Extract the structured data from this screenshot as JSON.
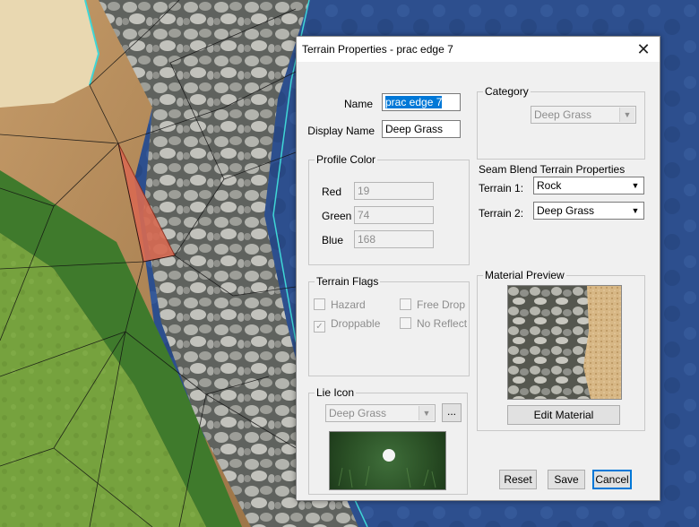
{
  "window": {
    "title": "Terrain Properties - prac edge 7",
    "close_glyph": "✕"
  },
  "fields": {
    "name_label": "Name",
    "name_value": "prac edge 7",
    "display_name_label": "Display Name",
    "display_name_value": "Deep Grass"
  },
  "profile_color": {
    "label": "Profile Color",
    "red_label": "Red",
    "red": "19",
    "green_label": "Green",
    "green": "74",
    "blue_label": "Blue",
    "blue": "168"
  },
  "terrain_flags": {
    "label": "Terrain Flags",
    "hazard": "Hazard",
    "free_drop": "Free Drop",
    "droppable": "Droppable",
    "no_reflect": "No Reflect"
  },
  "lie_icon": {
    "label": "Lie Icon",
    "value": "Deep Grass",
    "browse": "..."
  },
  "category": {
    "label": "Category",
    "value": "Deep Grass"
  },
  "seam_blend": {
    "label": "Seam Blend Terrain Properties",
    "terrain1_label": "Terrain 1:",
    "terrain1_value": "Rock",
    "terrain2_label": "Terrain 2:",
    "terrain2_value": "Deep Grass"
  },
  "material_preview": {
    "label": "Material Preview",
    "edit_button": "Edit Material"
  },
  "buttons": {
    "reset": "Reset",
    "save": "Save",
    "cancel": "Cancel"
  },
  "icons": {
    "close": "close-icon",
    "dropdown": "chevron-down-icon",
    "check": "checkmark-icon"
  },
  "colors": {
    "accent": "#0078d7",
    "dialog_bg": "#f0f0f0",
    "water": "#2c4f8c",
    "grass": "#6f9a3a",
    "sand": "#b88e5c",
    "selected_face": "#d86a52"
  }
}
